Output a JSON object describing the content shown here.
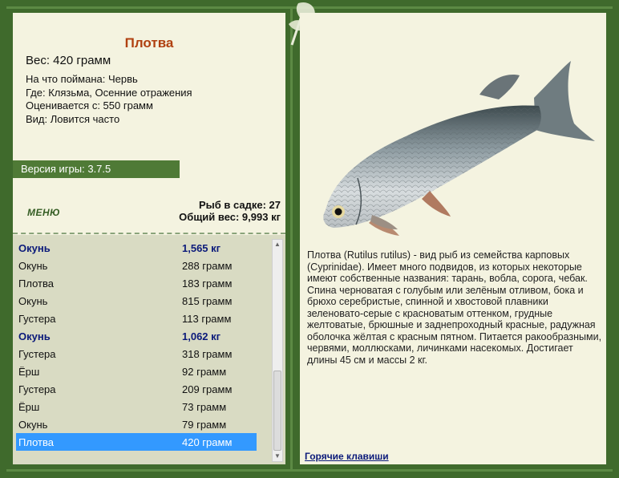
{
  "fish": {
    "title": "Плотва",
    "weight_line": "Вес: 420 грамм",
    "caught_on": "На что поймана: Червь",
    "location": "Где: Клязьма, Осенние отражения",
    "valued_from": "Оценивается с: 550 грамм",
    "kind": "Вид: Ловится часто",
    "description": "Плотва (Rutilus rutilus) - вид рыб из семейства карповых (Cyprinidae). Имеет много подвидов, из которых некоторые имеют собственные названия: тарань, вобла, сорога, чебак. Спина черноватая с голубым или зелёным отливом, бока и брюхо серебристые, спинной и хвостовой плавники зеленовато-серые с красноватым оттенком, грудные желтоватые, брюшные и заднепроходный красные, радужная оболочка жёлтая с красным пятном. Питается ракообразными, червями, моллюсками, личинками насекомых. Достигает длины 45 см и массы 2 кг."
  },
  "version": "Версия игры: 3.7.5",
  "menu_label": "МЕНЮ",
  "stats": {
    "count": "Рыб в садке: 27",
    "total_weight": "Общий вес: 9,993 кг"
  },
  "catch_list": [
    {
      "name": "Окунь",
      "weight": "1,565 кг",
      "bold": true
    },
    {
      "name": "Окунь",
      "weight": "288 грамм"
    },
    {
      "name": "Плотва",
      "weight": "183 грамм"
    },
    {
      "name": "Окунь",
      "weight": "815 грамм"
    },
    {
      "name": "Густера",
      "weight": "113 грамм"
    },
    {
      "name": "Окунь",
      "weight": "1,062 кг",
      "bold": true
    },
    {
      "name": "Густера",
      "weight": "318 грамм"
    },
    {
      "name": "Ёрш",
      "weight": "92 грамм"
    },
    {
      "name": "Густера",
      "weight": "209 грамм"
    },
    {
      "name": "Ёрш",
      "weight": "73 грамм"
    },
    {
      "name": "Окунь",
      "weight": "79 грамм"
    },
    {
      "name": "Плотва",
      "weight": "420 грамм",
      "selected": true
    }
  ],
  "hotkeys_label": "Горячие клавиши",
  "colors": {
    "frame": "#3f6a2c",
    "panel": "#f4f3e0",
    "title": "#b04010",
    "selection": "#3399ff",
    "bold_row": "#0b1a7a"
  }
}
